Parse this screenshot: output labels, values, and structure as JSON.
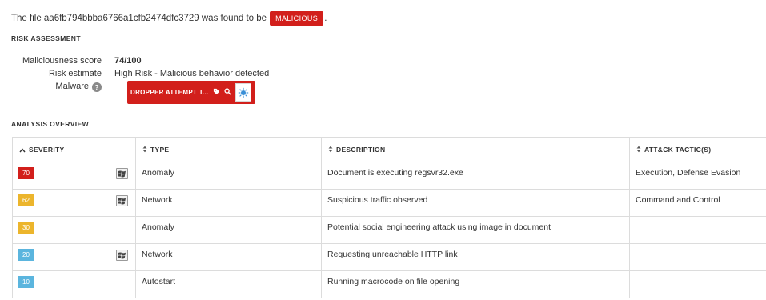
{
  "verdict": {
    "text": "The file aa6fb794bbba6766a1cfb2474dfc3729 was found to be",
    "badge": "MALICIOUS",
    "badge_color": "#d21f1b",
    "period": "."
  },
  "risk_assessment": {
    "heading": "RISK ASSESSMENT",
    "score_label": "Maliciousness score",
    "score_value": "74/100",
    "estimate_label": "Risk estimate",
    "estimate_value": "High Risk - Malicious behavior detected",
    "malware_label": "Malware",
    "help_icon": "?",
    "malware_tag": "DROPPER ATTEMPT T..."
  },
  "analysis_overview": {
    "heading": "ANALYSIS OVERVIEW",
    "columns": [
      "SEVERITY",
      "TYPE",
      "DESCRIPTION",
      "ATT&CK TACTIC(S)"
    ],
    "rows": [
      {
        "severity": "70",
        "color": "#d21f1b",
        "windows_icon": true,
        "type": "Anomaly",
        "description": "Document is executing regsvr32.exe",
        "tactics": "Execution, Defense Evasion"
      },
      {
        "severity": "62",
        "color": "#ecb52c",
        "windows_icon": true,
        "type": "Network",
        "description": "Suspicious traffic observed",
        "tactics": "Command and Control"
      },
      {
        "severity": "30",
        "color": "#ecb52c",
        "windows_icon": false,
        "type": "Anomaly",
        "description": "Potential social engineering attack using image in document",
        "tactics": ""
      },
      {
        "severity": "20",
        "color": "#5bb5de",
        "windows_icon": true,
        "type": "Network",
        "description": "Requesting unreachable HTTP link",
        "tactics": ""
      },
      {
        "severity": "10",
        "color": "#5bb5de",
        "windows_icon": false,
        "type": "Autostart",
        "description": "Running macrocode on file opening",
        "tactics": ""
      }
    ]
  }
}
